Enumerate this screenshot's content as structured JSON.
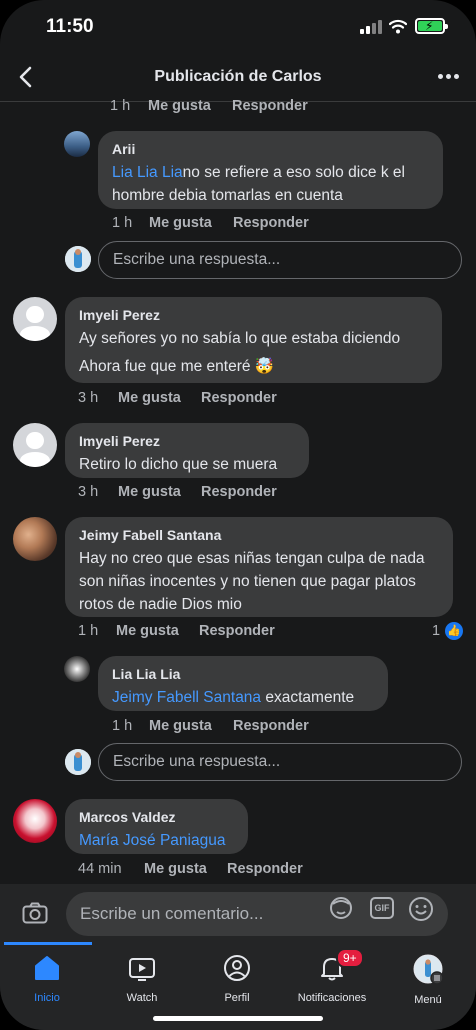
{
  "status_bar": {
    "time": "11:50"
  },
  "header": {
    "title": "Publicación de Carlos"
  },
  "comments": {
    "c0": {
      "time": "1 h",
      "like": "Me gusta",
      "reply": "Responder"
    },
    "c1": {
      "author": "Arii",
      "mention": "Lia Lia Lia",
      "text": "no se refiere a eso solo dice k el hombre debia tomarlas en cuenta",
      "time": "1 h",
      "like": "Me gusta",
      "reply": "Responder"
    },
    "reply1_placeholder": "Escribe una respuesta...",
    "c2": {
      "author": "Imyeli Perez",
      "text_line1": "Ay señores yo no sabía lo que estaba diciendo",
      "text_line2": "Ahora fue que me enteré",
      "emoji": "🤯",
      "time": "3 h",
      "like": "Me gusta",
      "reply": "Responder"
    },
    "c3": {
      "author": "Imyeli Perez",
      "text": "Retiro lo dicho que se muera",
      "time": "3 h",
      "like": "Me gusta",
      "reply": "Responder"
    },
    "c4": {
      "author": "Jeimy Fabell Santana",
      "text": "Hay no creo que esas niñas tengan culpa de nada son niñas inocentes y no tienen que pagar platos rotos de nadie Dios mio",
      "time": "1 h",
      "like": "Me gusta",
      "reply": "Responder",
      "reaction_count": "1"
    },
    "c5": {
      "author": "Lia Lia Lia",
      "mention": "Jeimy Fabell Santana",
      "text": " exactamente",
      "time": "1 h",
      "like": "Me gusta",
      "reply": "Responder"
    },
    "reply2_placeholder": "Escribe una respuesta...",
    "c6": {
      "author": "Marcos Valdez",
      "mention": "María José Paniagua",
      "time": "44 min",
      "like": "Me gusta",
      "reply": "Responder"
    }
  },
  "composer": {
    "placeholder": "Escribe un comentario...",
    "gif_label": "GIF"
  },
  "tabs": [
    {
      "label": "Inicio",
      "icon": "home-icon",
      "active": true
    },
    {
      "label": "Watch",
      "icon": "watch-icon"
    },
    {
      "label": "Perfil",
      "icon": "profile-icon"
    },
    {
      "label": "Notificaciones",
      "icon": "bell-icon",
      "badge": "9+"
    },
    {
      "label": "Menú",
      "icon": "menu-icon"
    }
  ],
  "colors": {
    "background": "#18191a",
    "bubble": "#3a3b3c",
    "mention": "#4599ff",
    "accent": "#2d88ff",
    "badge": "#e41e3f"
  }
}
